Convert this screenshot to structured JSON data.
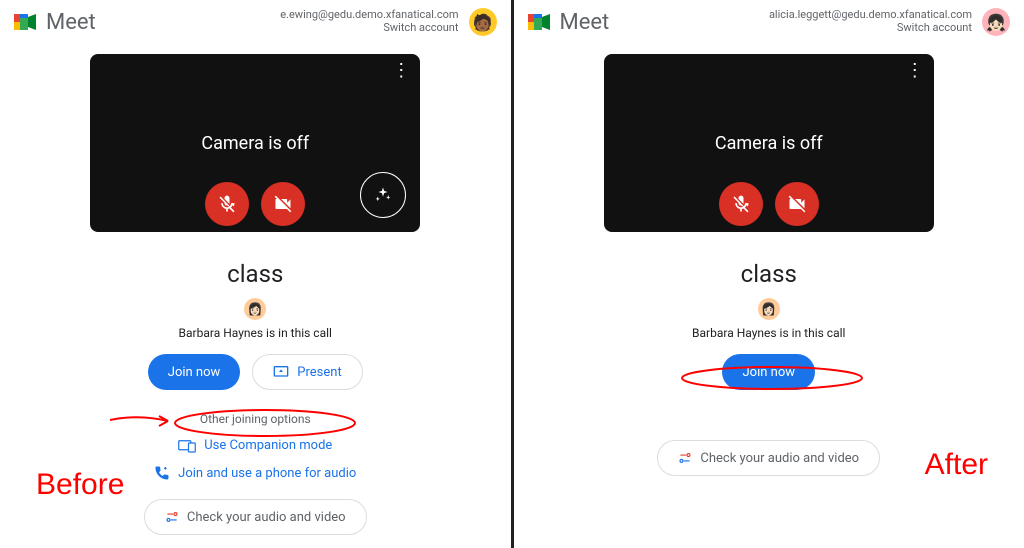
{
  "brand": "Meet",
  "left": {
    "email": "e.ewing@gedu.demo.xfanatical.com",
    "switch": "Switch account",
    "camera_off": "Camera is off",
    "meeting_name": "class",
    "caller": "Barbara Haynes is in this call",
    "join_now": "Join now",
    "present": "Present",
    "other_options": "Other joining options",
    "companion": "Use Companion mode",
    "phone": "Join and use a phone for audio",
    "check_av": "Check your audio and video",
    "annotation_label": "Before"
  },
  "right": {
    "email": "alicia.leggett@gedu.demo.xfanatical.com",
    "switch": "Switch account",
    "camera_off": "Camera is off",
    "meeting_name": "class",
    "caller": "Barbara Haynes is in this call",
    "join_now": "Join now",
    "check_av": "Check your audio and video",
    "annotation_label": "After"
  }
}
